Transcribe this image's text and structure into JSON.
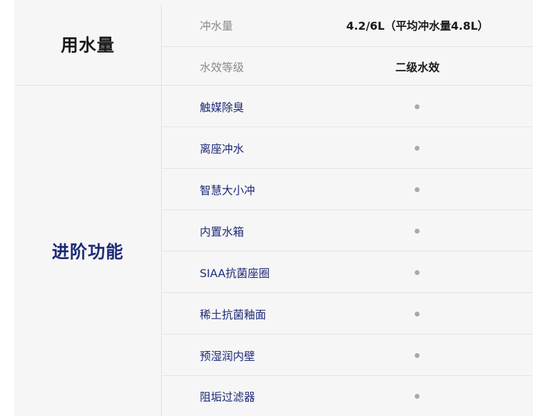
{
  "water_section": {
    "title": "用水量",
    "rows": [
      {
        "name": "冲水量",
        "value": "4.2/6L（平均冲水量4.8L）"
      },
      {
        "name": "水效等级",
        "value": "二级水效"
      }
    ]
  },
  "features_section": {
    "title": "进阶功能",
    "rows": [
      {
        "name": "触媒除臭",
        "supported": true
      },
      {
        "name": "离座冲水",
        "supported": true
      },
      {
        "name": "智慧大小冲",
        "supported": true
      },
      {
        "name": "内置水箱",
        "supported": true
      },
      {
        "name": "SIAA抗菌座圈",
        "supported": true
      },
      {
        "name": "稀土抗菌釉面",
        "supported": true
      },
      {
        "name": "预湿润内壁",
        "supported": true
      },
      {
        "name": "阻垢过滤器",
        "supported": true
      }
    ]
  },
  "colors": {
    "background": "#f6f6f6",
    "feature_text": "#1e2a78",
    "muted_text": "#8a8a8a",
    "dot": "#a9a9a9"
  }
}
